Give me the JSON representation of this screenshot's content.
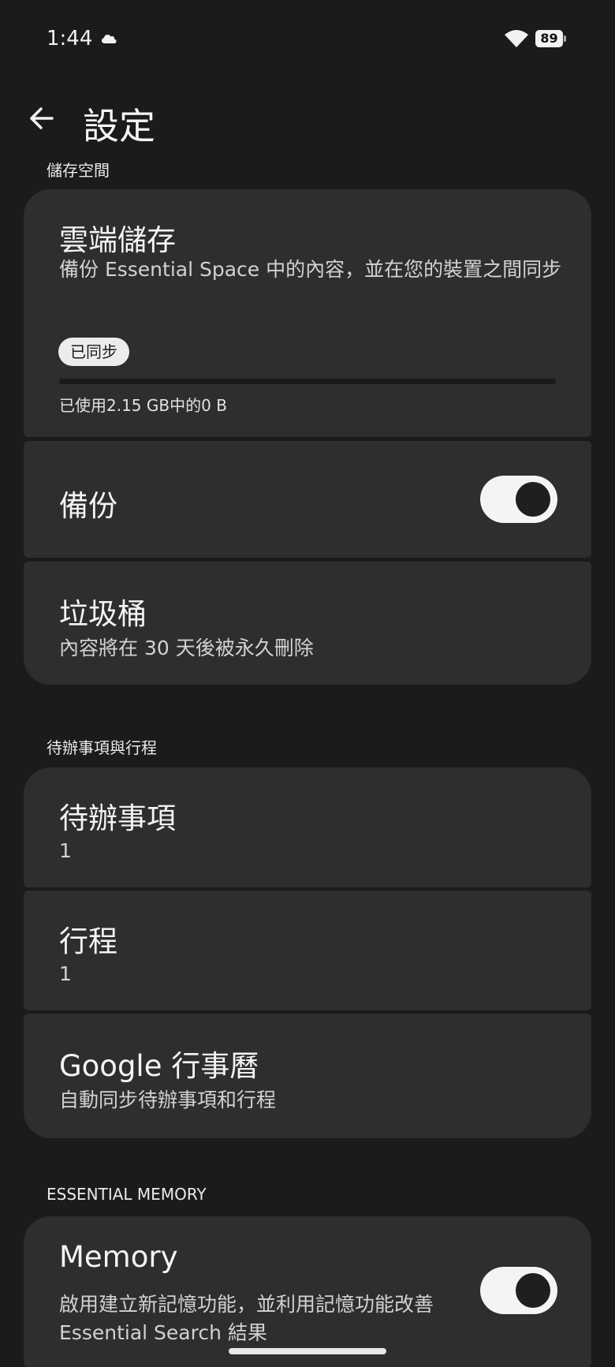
{
  "status_bar": {
    "time": "1:44",
    "battery": "89",
    "icons": [
      "cloud-icon",
      "wifi-icon",
      "battery-icon"
    ]
  },
  "header": {
    "title": "設定",
    "back_icon": "arrow-left-icon"
  },
  "storage_section": {
    "header": "儲存空間",
    "cloud": {
      "title": "雲端儲存",
      "subtitle": "備份 Essential Space 中的內容，並在您的裝置之間同步",
      "chip": "已同步",
      "usage_fraction": 0,
      "usage_text": "已使用2.15 GB中的0 B"
    },
    "backup": {
      "title": "備份",
      "toggle_on": true
    },
    "trash": {
      "title": "垃圾桶",
      "subtitle": "內容將在 30 天後被永久刪除"
    }
  },
  "todo_section": {
    "header": "待辦事項與行程",
    "todos": {
      "title": "待辦事項",
      "value": "1"
    },
    "schedule": {
      "title": "行程",
      "value": "1"
    },
    "gcal": {
      "title": "Google 行事曆",
      "subtitle": "自動同步待辦事項和行程"
    }
  },
  "memory_section": {
    "header": "ESSENTIAL MEMORY",
    "memory": {
      "title": "Memory",
      "subtitle": "啟用建立新記憶功能，並利用記憶功能改善 Essential Search 結果",
      "toggle_on": true
    }
  },
  "colors": {
    "background": "#1b1b1b",
    "card": "#2e2e2e",
    "toggle_track": "#f4f4f4",
    "toggle_knob": "#1f1f1f"
  }
}
